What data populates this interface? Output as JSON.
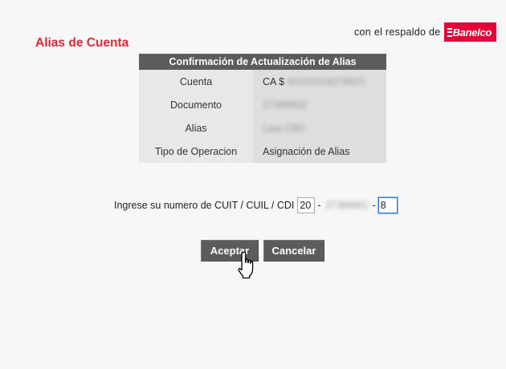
{
  "backed_by": {
    "text": "con el respaldo de",
    "logo_text": "Banelco",
    "logo_color": "#e3003b"
  },
  "page": {
    "title": "Alias de Cuenta",
    "title_color": "#d42b3a"
  },
  "confirmation": {
    "header": "Confirmación de Actualización de Alias",
    "rows": [
      {
        "label": "Cuenta",
        "prefix": "CA $ ",
        "value": "00150319278825"
      },
      {
        "label": "Documento",
        "prefix": "",
        "value": "27389802"
      },
      {
        "label": "Alias",
        "prefix": "",
        "value": "Laur.CBC"
      },
      {
        "label": "Tipo de Operacion",
        "prefix": "",
        "value": "Asignación de Alias"
      }
    ]
  },
  "cuit": {
    "label": "Ingrese su numero de CUIT / CUIL / CDI",
    "part1": "20",
    "part2": "27389802",
    "part3": "8",
    "separator": "-"
  },
  "buttons": {
    "accept": "Aceptar",
    "cancel": "Cancelar"
  },
  "colors": {
    "table_header_bg": "#5c5c5c",
    "button_bg": "#5c5c5c"
  }
}
